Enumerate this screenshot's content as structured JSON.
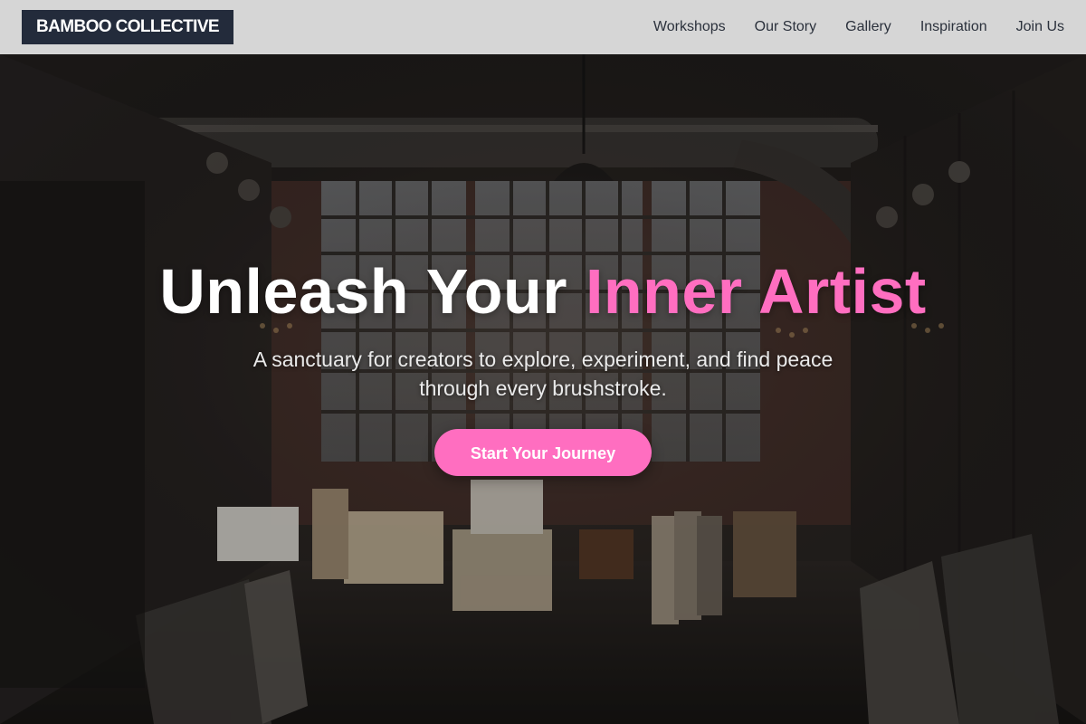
{
  "header": {
    "logo": "BAMBOO COLLECTIVE",
    "nav": [
      {
        "label": "Workshops"
      },
      {
        "label": "Our Story"
      },
      {
        "label": "Gallery"
      },
      {
        "label": "Inspiration"
      },
      {
        "label": "Join Us"
      }
    ]
  },
  "hero": {
    "title_main": "Unleash Your ",
    "title_accent": "Inner Artist",
    "subtitle": "A sanctuary for creators to explore, experiment, and find peace through every brushstroke.",
    "cta_label": "Start Your Journey",
    "background_image": "art-studio-warehouse-photo"
  },
  "colors": {
    "header_bg": "#d6d6d6",
    "logo_bg": "#232b3b",
    "accent": "#ff6ec0",
    "nav_text": "#2b313c"
  }
}
